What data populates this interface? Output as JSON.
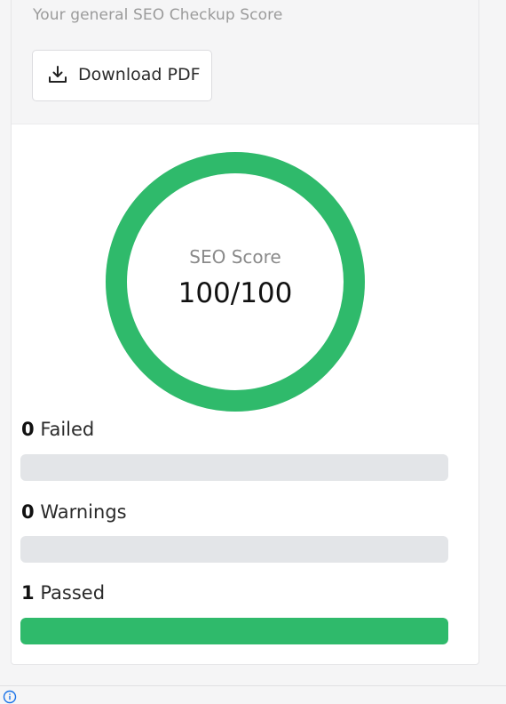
{
  "header": {
    "subtitle": "Your general SEO Checkup Score",
    "download_label": "Download PDF"
  },
  "score": {
    "label": "SEO Score",
    "value_text": "100/100",
    "fraction": 1.0,
    "color": "#2fba6b"
  },
  "stats": [
    {
      "count": "0",
      "label": "Failed",
      "fraction": 0.0
    },
    {
      "count": "0",
      "label": "Warnings",
      "fraction": 0.0
    },
    {
      "count": "1",
      "label": "Passed",
      "fraction": 1.0
    }
  ],
  "colors": {
    "accent": "#2fba6b",
    "track": "#e3e5e8",
    "info": "#1a73e8"
  },
  "icons": {
    "download": "download-icon",
    "info": "info-icon"
  }
}
